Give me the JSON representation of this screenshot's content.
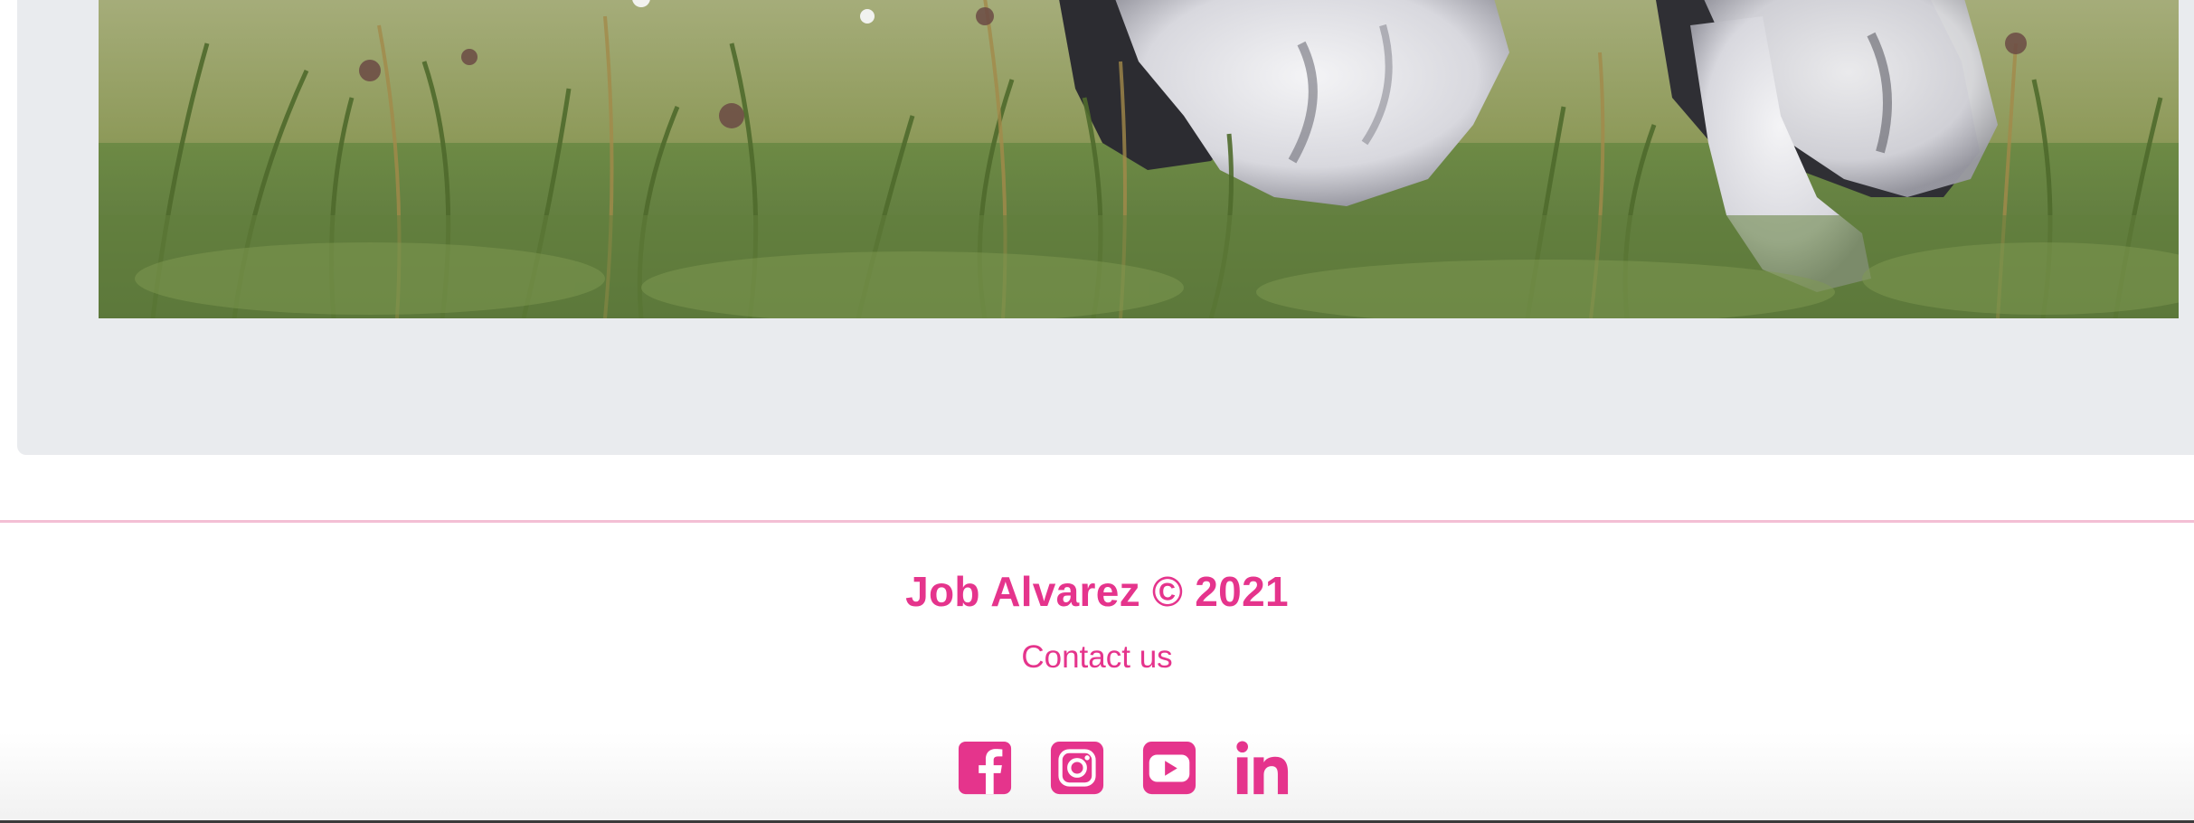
{
  "photo": {
    "alt": "Dog running through tall grass"
  },
  "footer": {
    "copyright": "Job Alvarez © 2021",
    "contact_label": "Contact us",
    "accent_color": "#e5348c"
  },
  "socials": [
    {
      "icon": "facebook-icon",
      "label": "Facebook"
    },
    {
      "icon": "instagram-icon",
      "label": "Instagram"
    },
    {
      "icon": "youtube-icon",
      "label": "YouTube"
    },
    {
      "icon": "linkedin-icon",
      "label": "LinkedIn"
    }
  ]
}
